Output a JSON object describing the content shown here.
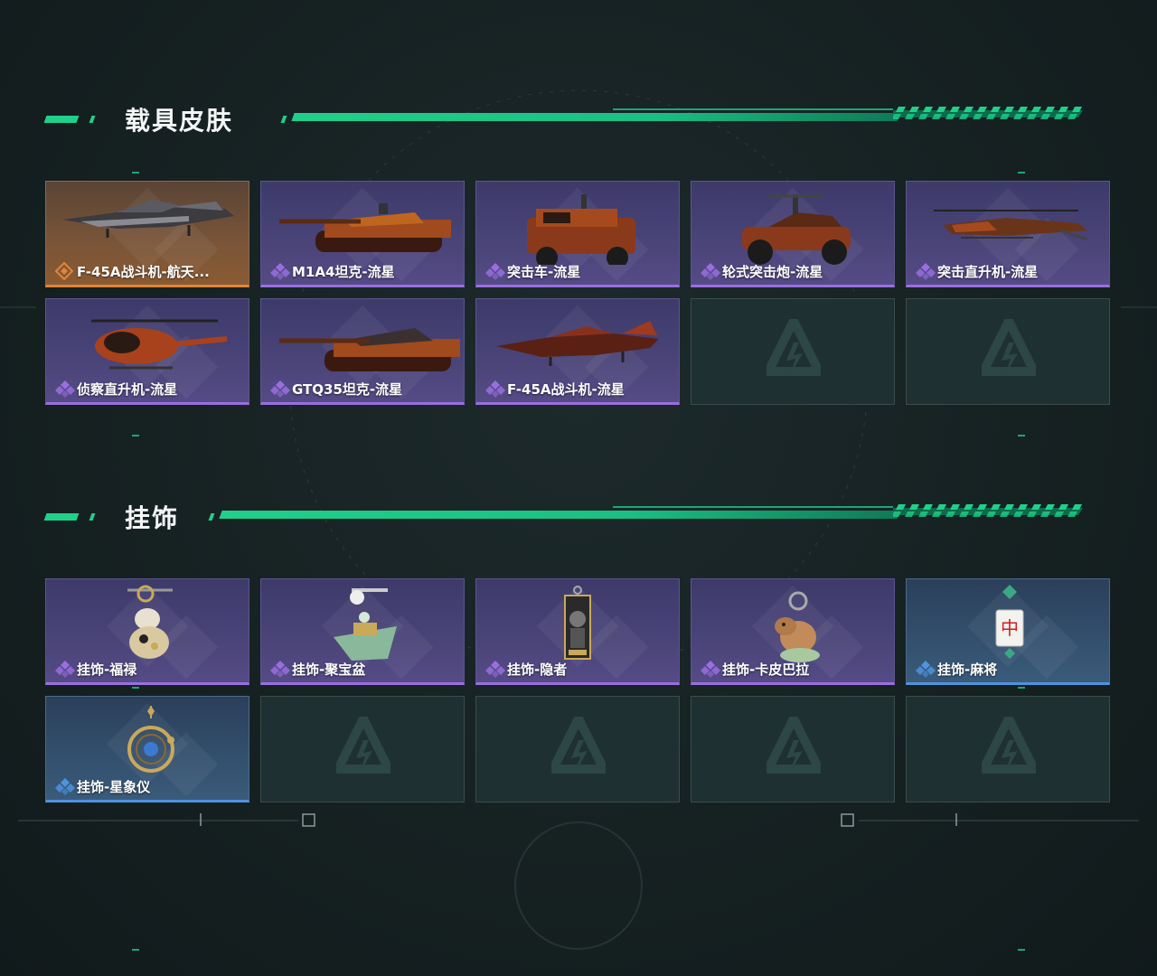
{
  "sections": [
    {
      "title": "载具皮肤",
      "items": [
        {
          "label": "F-45A战斗机-航天...",
          "rarity": "orange",
          "art": "jet"
        },
        {
          "label": "M1A4坦克-流星",
          "rarity": "purple",
          "art": "tank"
        },
        {
          "label": "突击车-流星",
          "rarity": "purple",
          "art": "truck"
        },
        {
          "label": "轮式突击炮-流星",
          "rarity": "purple",
          "art": "buggy"
        },
        {
          "label": "突击直升机-流星",
          "rarity": "purple",
          "art": "apache"
        },
        {
          "label": "侦察直升机-流星",
          "rarity": "purple",
          "art": "scout"
        },
        {
          "label": "GTQ35坦克-流星",
          "rarity": "purple",
          "art": "tank2"
        },
        {
          "label": "F-45A战斗机-流星",
          "rarity": "purple",
          "art": "jet2"
        }
      ],
      "empty_slots": 2
    },
    {
      "title": "挂饰",
      "items": [
        {
          "label": "挂饰-福禄",
          "rarity": "purple",
          "art": "gourd"
        },
        {
          "label": "挂饰-聚宝盆",
          "rarity": "purple",
          "art": "bowl"
        },
        {
          "label": "挂饰-隐者",
          "rarity": "purple",
          "art": "card"
        },
        {
          "label": "挂饰-卡皮巴拉",
          "rarity": "purple",
          "art": "capy"
        },
        {
          "label": "挂饰-麻将",
          "rarity": "blue",
          "art": "mahjong"
        },
        {
          "label": "挂饰-星象仪",
          "rarity": "blue",
          "art": "astro"
        }
      ],
      "empty_slots": 4
    }
  ],
  "mahjong_glyph": "中",
  "colors": {
    "accent": "#1fd08a",
    "purple_edge": "#9a6ee0",
    "orange_edge": "#e0853a",
    "blue_edge": "#4e93e0"
  }
}
